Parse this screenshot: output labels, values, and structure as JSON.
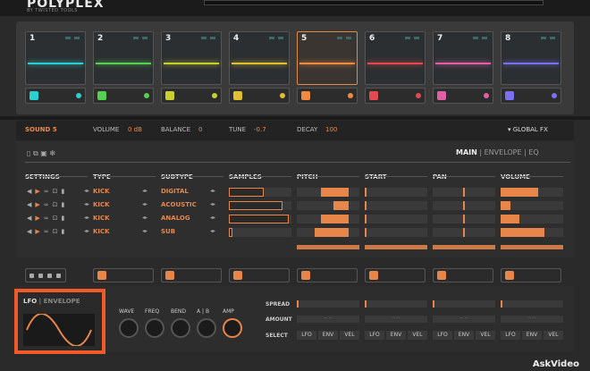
{
  "app": {
    "logo": "POLYPLEX",
    "logo_sub": "BY TWISTED TOOLS"
  },
  "pads": [
    {
      "num": "1",
      "color": "#2ad0d0"
    },
    {
      "num": "2",
      "color": "#55d050"
    },
    {
      "num": "3",
      "color": "#c8d030"
    },
    {
      "num": "4",
      "color": "#e0c030"
    },
    {
      "num": "5",
      "color": "#f08a40"
    },
    {
      "num": "6",
      "color": "#e04a50"
    },
    {
      "num": "7",
      "color": "#e060a8"
    },
    {
      "num": "8",
      "color": "#7a70f0"
    }
  ],
  "header": {
    "sound_label": "SOUND 5",
    "volume_label": "VOLUME",
    "volume_value": "0 dB",
    "balance_label": "BALANCE",
    "balance_value": "0",
    "tune_label": "TUNE",
    "tune_value": "-0.7",
    "decay_label": "DECAY",
    "decay_value": "100",
    "global_fx": "GLOBAL FX"
  },
  "tabs": {
    "main": "MAIN",
    "envelope": "ENVELOPE",
    "eq": "EQ",
    "sep": "|"
  },
  "columns": {
    "settings": "SETTINGS",
    "type": "TYPE",
    "subtype": "SUBTYPE",
    "samples": "SAMPLES",
    "pitch": "PITCH",
    "start": "START",
    "pan": "PAN",
    "volume": "VOLUME"
  },
  "layers": [
    {
      "type": "KICK",
      "subtype": "DIGITAL",
      "sample": 0.55,
      "pitch": 0.45,
      "start": 0.0,
      "pan": 0.5,
      "volume": 0.6
    },
    {
      "type": "KICK",
      "subtype": "ACOUSTIC",
      "sample": 0.85,
      "pitch": 0.25,
      "start": 0.0,
      "pan": 0.5,
      "volume": 0.15
    },
    {
      "type": "KICK",
      "subtype": "ANALOG",
      "sample": 0.95,
      "pitch": 0.45,
      "start": 0.0,
      "pan": 0.5,
      "volume": 0.3
    },
    {
      "type": "KICK",
      "subtype": "SUB",
      "sample": 0.05,
      "pitch": 0.55,
      "start": 0.0,
      "pan": 0.5,
      "volume": 0.7
    }
  ],
  "lfo": {
    "title": "LFO",
    "sep": "|",
    "envelope": "ENVELOPE",
    "knobs": [
      "WAVE",
      "FREQ",
      "BEND",
      "A | B",
      "AMP"
    ],
    "spread": "SPREAD",
    "amount": "AMOUNT",
    "select": "SELECT",
    "amount_value": "-- --",
    "selects": [
      "LFO",
      "ENV",
      "VEL"
    ]
  },
  "watermark": "AskVideo"
}
